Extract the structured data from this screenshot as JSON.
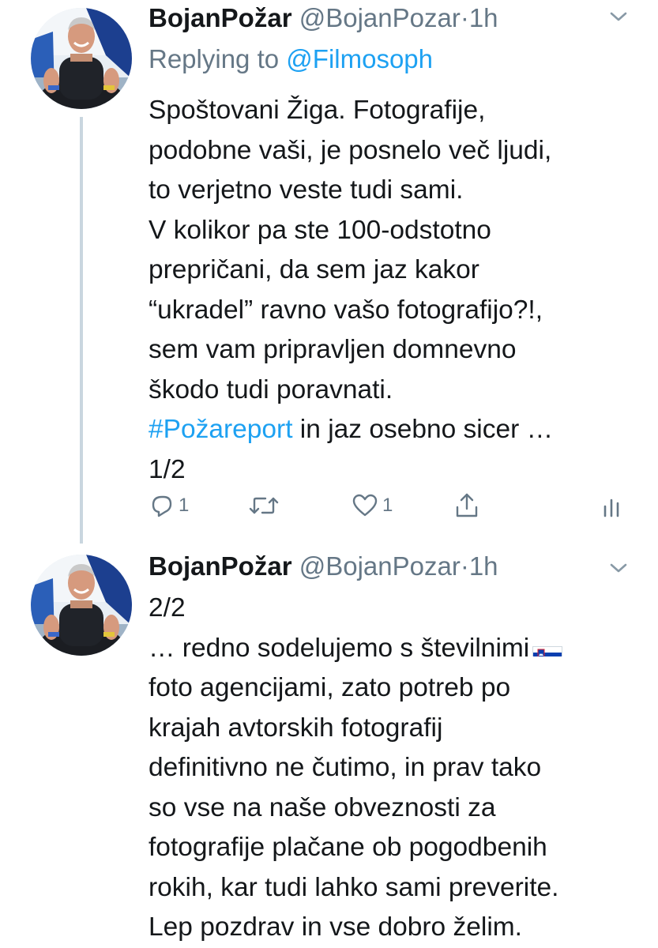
{
  "tweets": [
    {
      "author": {
        "name": "BojanPožar",
        "handle": "@BojanPozar",
        "separator": "·",
        "time": "1h",
        "avatar_icon": "profile-photo"
      },
      "replying_prefix": "Replying to",
      "replying_to": "@Filmosoph",
      "lines": [
        "Spoštovani Žiga. Fotografije,",
        "podobne vaši, je posnelo več ljudi,",
        "to verjetno veste tudi sami.",
        "V kolikor pa ste 100-odstotno",
        "prepričani, da sem jaz kakor",
        "“ukradel” ravno vašo fotografijo?!,",
        "sem vam pripravljen domnevno",
        "škodo tudi poravnati."
      ],
      "hashtag": "#Požareport",
      "hashtag_tail": " in jaz osebno sicer …",
      "last_line": "1/2",
      "actions": {
        "reply_count": "1",
        "retweet_count": "",
        "like_count": "1",
        "reply_icon": "reply-icon",
        "retweet_icon": "retweet-icon",
        "like_icon": "heart-icon",
        "share_icon": "share-icon",
        "analytics_icon": "analytics-icon"
      }
    },
    {
      "author": {
        "name": "BojanPožar",
        "handle": "@BojanPozar",
        "separator": "·",
        "time": "1h",
        "avatar_icon": "profile-photo"
      },
      "first_line": "2/2",
      "line_with_flag": "… redno sodelujemo s številnimi",
      "flag_icon": "slovenia-flag-icon",
      "lines": [
        "foto agencijami, zato potreb po",
        "krajah avtorskih fotografij",
        "definitivno ne čutimo, in prav tako",
        "so vse na naše obveznosti za",
        "fotografije plačane ob pogodbenih",
        "rokih, kar tudi lahko sami preverite.",
        "Lep pozdrav in vse dobro želim."
      ]
    }
  ],
  "colors": {
    "link": "#1da1f2",
    "secondary_text": "#657786",
    "primary_text": "#14171a",
    "thread_line": "#c9d6df"
  }
}
